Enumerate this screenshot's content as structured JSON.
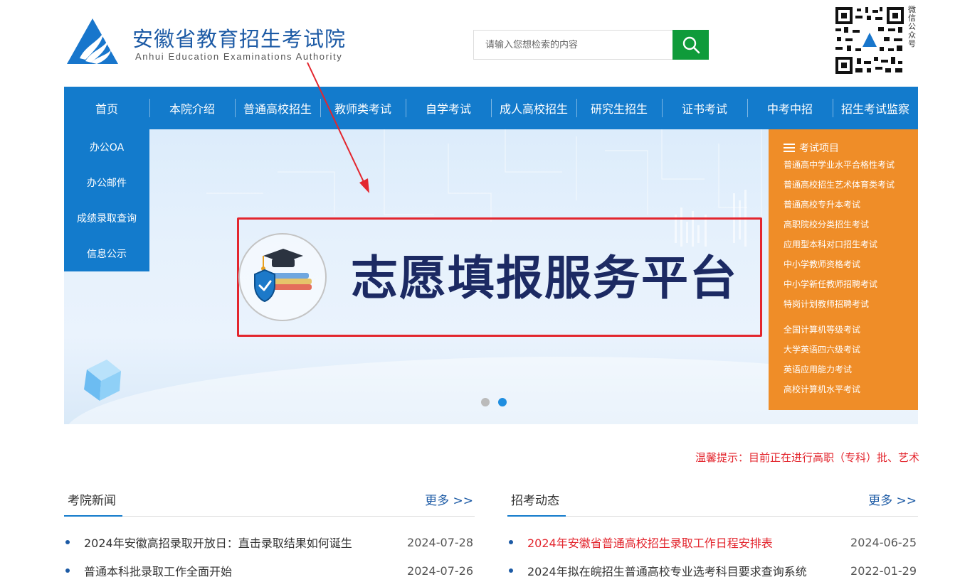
{
  "header": {
    "site_name_cn": "安徽省教育招生考试院",
    "site_name_en": "Anhui Education Examinations Authority",
    "search_placeholder": "请输入您想检索的内容",
    "qr_caption": "微信公众号"
  },
  "nav": {
    "items": [
      "首页",
      "本院介绍",
      "普通高校招生",
      "教师类考试",
      "自学考试",
      "成人高校招生",
      "研究生招生",
      "证书考试",
      "中考中招",
      "招生考试监察"
    ]
  },
  "side_menu": {
    "items": [
      "办公OA",
      "办公邮件",
      "成绩录取查询",
      "信息公示"
    ]
  },
  "exam_panel": {
    "title": "考试项目",
    "group1": [
      "普通高中学业水平合格性考试",
      "普通高校招生艺术体育类考试",
      "普通高校专升本考试",
      "高职院校分类招生考试",
      "应用型本科对口招生考试",
      "中小学教师资格考试",
      "中小学新任教师招聘考试",
      "特岗计划教师招聘考试"
    ],
    "group2": [
      "全国计算机等级考试",
      "大学英语四六级考试",
      "英语应用能力考试",
      "高校计算机水平考试"
    ]
  },
  "banner": {
    "platform_title": "志愿填报服务平台",
    "slide_count": 2,
    "active_slide": 2
  },
  "notice": {
    "text": "温馨提示：目前正在进行高职（专科）批、艺术"
  },
  "news_left": {
    "title": "考院新闻",
    "more": "更多 >>",
    "items": [
      {
        "title": "2024年安徽高招录取开放日：直击录取结果如何诞生",
        "date": "2024-07-28"
      },
      {
        "title": "普通本科批录取工作全面开始",
        "date": "2024-07-26"
      }
    ]
  },
  "news_right": {
    "title": "招考动态",
    "more": "更多 >>",
    "items": [
      {
        "title": "2024年安徽省普通高校招生录取工作日程安排表",
        "date": "2024-06-25"
      },
      {
        "title": "2024年拟在皖招生普通高校专业选考科目要求查询系统",
        "date": "2022-01-29"
      }
    ]
  },
  "colors": {
    "nav_blue": "#137bcc",
    "search_green": "#0f9b3a",
    "exam_orange": "#ef8d28",
    "highlight_red": "#e3262e",
    "platform_navy": "#1c2a63"
  },
  "icons": [
    "logo-icon",
    "search-icon",
    "qr-code-icon",
    "menu-list-icon",
    "graduation-cap-icon",
    "shield-check-icon",
    "cube-icon",
    "arrow-annotation"
  ]
}
